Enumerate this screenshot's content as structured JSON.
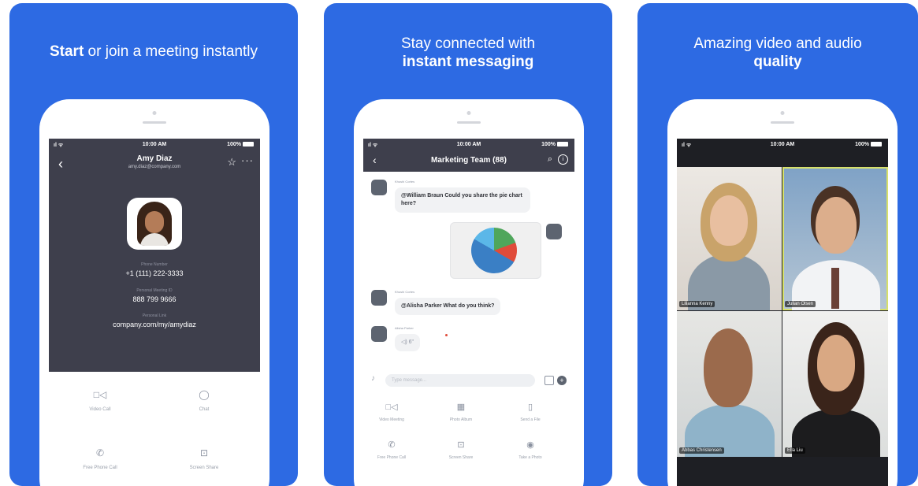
{
  "panels": [
    {
      "heading_bold": "Start",
      "heading_rest": " or join a meeting instantly",
      "status": {
        "signal": "ıl ᯤ",
        "time": "10:00 AM",
        "battery": "100%"
      },
      "contact": {
        "name": "Amy Diaz",
        "email": "amy.diaz@company.com",
        "fields": [
          {
            "label": "Phone Number",
            "value": "+1 (111) 222-3333"
          },
          {
            "label": "Personal Meeting ID",
            "value": "888 799 9666"
          },
          {
            "label": "Personal Link",
            "value": "company.com/my/amydiaz"
          }
        ]
      },
      "actions": [
        {
          "icon": "□◁",
          "label": "Video Call"
        },
        {
          "icon": "◯",
          "label": "Chat"
        },
        {
          "icon": "✆",
          "label": "Free Phone Call"
        },
        {
          "icon": "⊡",
          "label": "Screen Share"
        }
      ]
    },
    {
      "heading_line1": "Stay connected with",
      "heading_line2": "instant messaging",
      "status": {
        "signal": "ıl ᯤ",
        "time": "10:00 AM",
        "battery": "100%"
      },
      "chat_title": "Marketing Team (88)",
      "messages": [
        {
          "sender": "Khushi Cortes",
          "text": "@William Braun Could you share the pie chart here?"
        },
        {
          "sender": "Khushi Cortes",
          "text": "@Alisha Parker What do you think?"
        },
        {
          "sender": "Alisha Parker",
          "text": "◁) 6\""
        }
      ],
      "composer_placeholder": "Type message...",
      "actions": [
        {
          "icon": "□◁",
          "label": "Video Meeting"
        },
        {
          "icon": "▦",
          "label": "Photo Album"
        },
        {
          "icon": "▯",
          "label": "Send a File"
        },
        {
          "icon": "✆",
          "label": "Free Phone Call"
        },
        {
          "icon": "⊡",
          "label": "Screen Share"
        },
        {
          "icon": "◉",
          "label": "Take a Photo"
        }
      ]
    },
    {
      "heading_line1": "Amazing video and audio",
      "heading_line2": "quality",
      "status": {
        "signal": "ıl ᯤ",
        "time": "10:00 AM",
        "battery": "100%"
      },
      "participants": [
        {
          "name": "Lilianna Kenny"
        },
        {
          "name": "Julian Olsen"
        },
        {
          "name": "Abbas Christensen"
        },
        {
          "name": "Ella Liu"
        }
      ]
    }
  ],
  "colors": {
    "brand_blue": "#2d6ae3",
    "dark_header": "#3e3f4c",
    "active_speaker": "#d7e06a"
  }
}
